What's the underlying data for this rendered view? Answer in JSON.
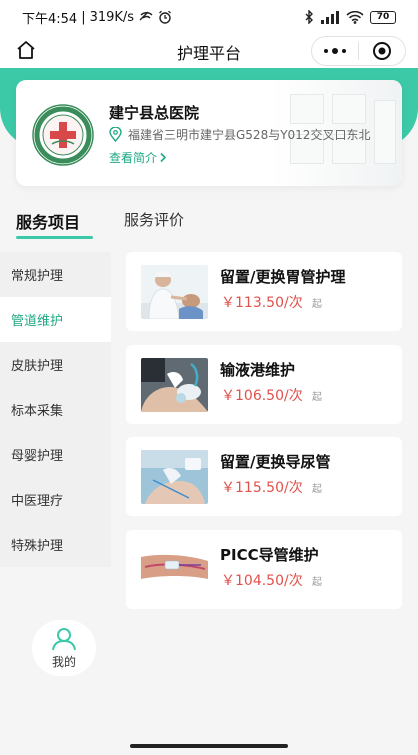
{
  "status_bar": {
    "time": "下午4:54",
    "net_speed": "319K/s",
    "battery": "70"
  },
  "nav": {
    "title": "护理平台"
  },
  "hospital": {
    "name": "建宁县总医院",
    "address": "福建省三明市建宁县G528与Y012交叉口东北",
    "intro_link": "查看简介"
  },
  "tabs": [
    {
      "label": "服务项目",
      "active": true
    },
    {
      "label": "服务评价",
      "active": false
    }
  ],
  "categories": [
    {
      "label": "常规护理",
      "active": false
    },
    {
      "label": "管道维护",
      "active": true
    },
    {
      "label": "皮肤护理",
      "active": false
    },
    {
      "label": "标本采集",
      "active": false
    },
    {
      "label": "母婴护理",
      "active": false
    },
    {
      "label": "中医理疗",
      "active": false
    },
    {
      "label": "特殊护理",
      "active": false
    }
  ],
  "services": [
    {
      "name": "留置/更换胃管护理",
      "price": "￥113.50/次",
      "suffix": "起",
      "image": "nurse-gastric-tube-photo"
    },
    {
      "name": "输液港维护",
      "price": "￥106.50/次",
      "suffix": "起",
      "image": "infusion-port-care-photo"
    },
    {
      "name": "留置/更换导尿管",
      "price": "￥115.50/次",
      "suffix": "起",
      "image": "urinary-catheter-photo"
    },
    {
      "name": "PICC导管维护",
      "price": "￥104.50/次",
      "suffix": "起",
      "image": "picc-line-arm-photo"
    }
  ],
  "profile": {
    "label": "我的"
  },
  "colors": {
    "accent": "#3cc9a8",
    "accent_text": "#1fa884",
    "price": "#e0524c"
  }
}
